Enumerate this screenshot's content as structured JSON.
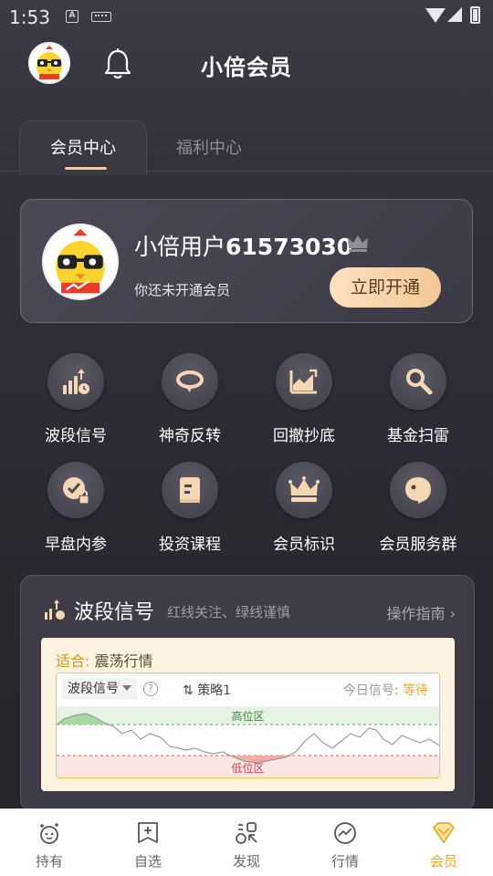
{
  "status_bar": {
    "time": "1:53"
  },
  "header": {
    "title": "小倍会员"
  },
  "tabs": [
    {
      "label": "会员中心",
      "active": true
    },
    {
      "label": "福利中心",
      "active": false
    }
  ],
  "user": {
    "name_prefix": "小倍用户",
    "user_id": "61573030",
    "status": "你还未开通会员",
    "open_button": "立即开通"
  },
  "features": [
    {
      "label": "波段信号",
      "icon": "bar-signal-icon"
    },
    {
      "label": "神奇反转",
      "icon": "reverse-icon"
    },
    {
      "label": "回撤抄底",
      "icon": "trend-chart-icon"
    },
    {
      "label": "基金扫雷",
      "icon": "magnifier-icon"
    },
    {
      "label": "早盘内参",
      "icon": "check-lock-icon"
    },
    {
      "label": "投资课程",
      "icon": "book-icon"
    },
    {
      "label": "会员标识",
      "icon": "crown-icon"
    },
    {
      "label": "会员服务群",
      "icon": "chat-icon"
    }
  ],
  "signal_card": {
    "title": "波段信号",
    "subtitle": "红线关注、绿线谨慎",
    "guide": "操作指南",
    "suit_label": "适合:",
    "suit_value": "震荡行情",
    "selector": "波段信号",
    "strategy": "策略1",
    "today_label": "今日信号:",
    "today_value": "等待",
    "high_zone": "高位区",
    "low_zone": "低位区"
  },
  "bottom_nav": [
    {
      "label": "持有",
      "icon": "holding-icon",
      "active": false
    },
    {
      "label": "自选",
      "icon": "watchlist-icon",
      "active": false
    },
    {
      "label": "发现",
      "icon": "discover-icon",
      "active": false
    },
    {
      "label": "行情",
      "icon": "market-icon",
      "active": false
    },
    {
      "label": "会员",
      "icon": "diamond-icon",
      "active": true
    }
  ],
  "colors": {
    "accent_gold": "#f3c796",
    "signal_wait": "#e9a92c",
    "high_zone": "#3c8b3a",
    "low_zone": "#d64545"
  }
}
